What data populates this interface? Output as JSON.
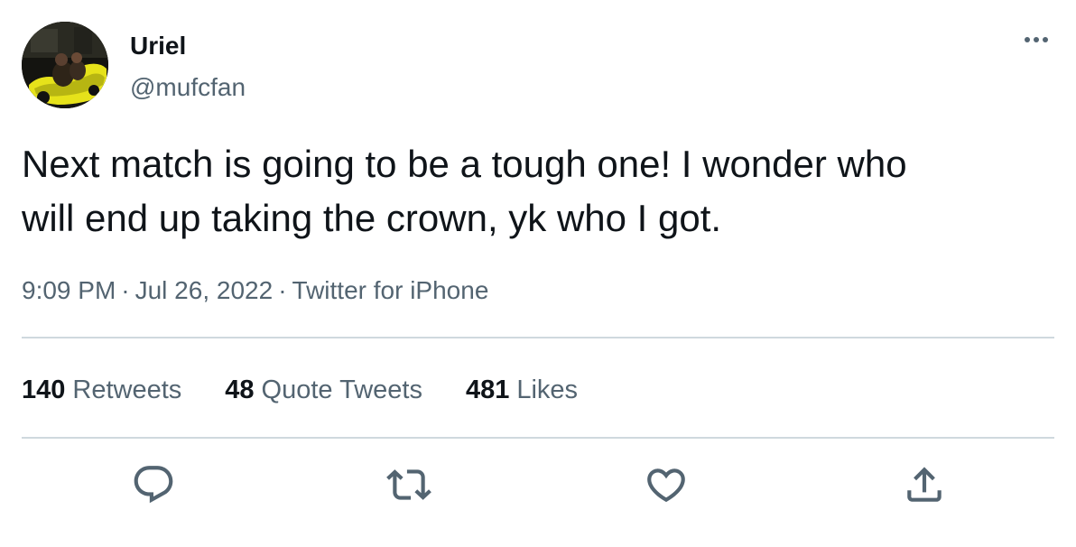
{
  "user": {
    "display_name": "Uriel",
    "handle": "@mufcfan",
    "avatar_icon": "profile-photo"
  },
  "tweet": {
    "text": "Next match is going to be a tough one! I wonder who\nwill end up taking the crown, yk who I got.",
    "time": "9:09 PM",
    "date": "Jul 26, 2022",
    "source": "Twitter for iPhone",
    "separator": "·"
  },
  "stats": {
    "retweets_count": "140",
    "retweets_label": "Retweets",
    "quotes_count": "48",
    "quotes_label": "Quote Tweets",
    "likes_count": "481",
    "likes_label": "Likes"
  },
  "actions": {
    "reply_icon": "reply-icon",
    "retweet_icon": "retweet-icon",
    "like_icon": "heart-icon",
    "share_icon": "share-icon",
    "more_icon": "more-icon"
  },
  "colors": {
    "text_primary": "#0f1419",
    "text_secondary": "#536471",
    "divider": "#cfd9de",
    "avatar_accent": "#e6e21a"
  }
}
